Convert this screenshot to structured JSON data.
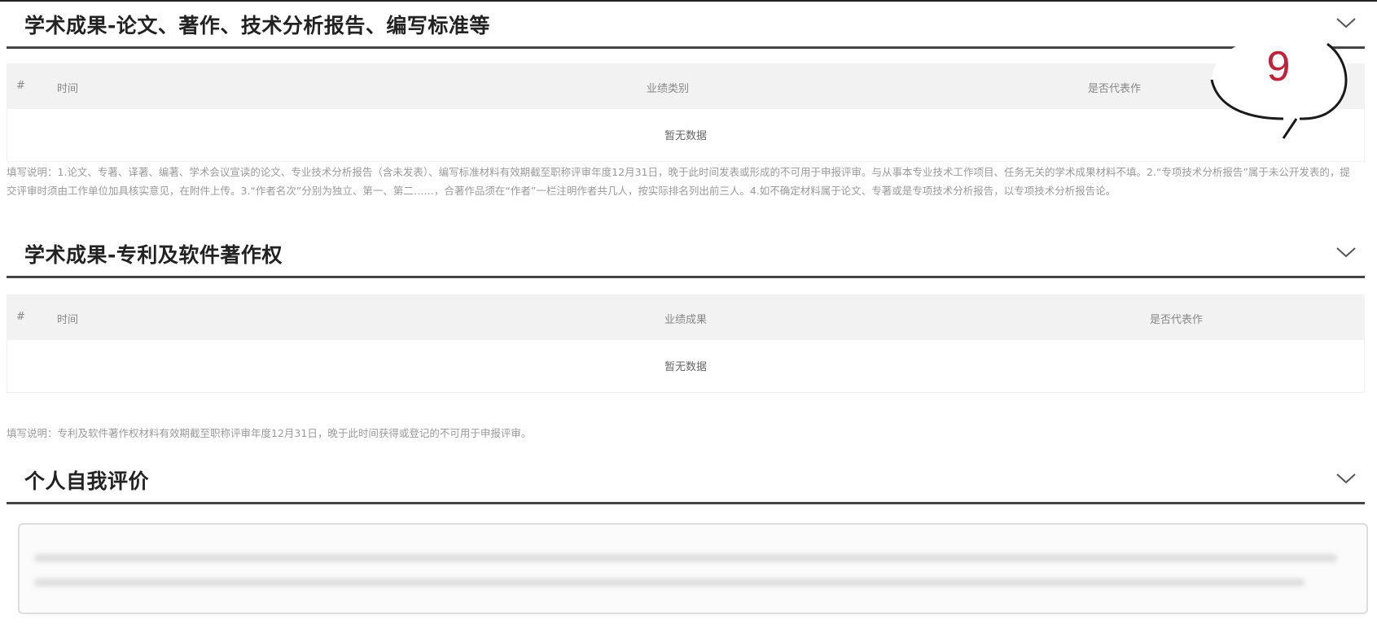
{
  "sections": {
    "papers": {
      "title": "学术成果-论文、著作、技术分析报告、编写标准等",
      "columns": [
        "#",
        "时间",
        "业绩类别",
        "是否代表作"
      ],
      "empty_text": "暂无数据",
      "note": "填写说明：1.论文、专著、译著、编著、学术会议宣读的论文、专业技术分析报告（含未发表）、编写标准材料有效期截至职称评审年度12月31日，晚于此时间发表或形成的不可用于申报评审。与从事本专业技术工作项目、任务无关的学术成果材料不填。2.“专项技术分析报告”属于未公开发表的，提交评审时须由工作单位加具核实意见，在附件上传。3.“作者名次”分别为独立、第一、第二……，合著作品须在“作者”一栏注明作者共几人，按实际排名列出前三人。4.如不确定材料属于论文、专著或是专项技术分析报告，以专项技术分析报告论。"
    },
    "patents": {
      "title": "学术成果-专利及软件著作权",
      "columns": [
        "#",
        "时间",
        "业绩成果",
        "是否代表作"
      ],
      "empty_text": "暂无数据",
      "note": "填写说明：专利及软件著作权材料有效期截至职称评审年度12月31日，晚于此时间获得或登记的不可用于申报评审。"
    },
    "self_eval": {
      "title": "个人自我评价"
    }
  },
  "annotation": {
    "number": "9"
  },
  "icons": {
    "collapse": "chevron-down-icon"
  },
  "colors": {
    "annotation": "#c0223a",
    "section_rule": "#444444",
    "table_header_bg": "#f2f2f2"
  }
}
